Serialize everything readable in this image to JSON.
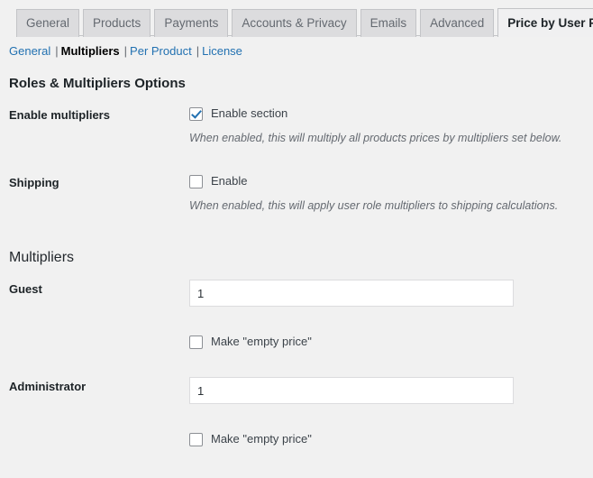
{
  "tabs": [
    {
      "label": "General",
      "active": false
    },
    {
      "label": "Products",
      "active": false
    },
    {
      "label": "Payments",
      "active": false
    },
    {
      "label": "Accounts & Privacy",
      "active": false
    },
    {
      "label": "Emails",
      "active": false
    },
    {
      "label": "Advanced",
      "active": false
    },
    {
      "label": "Price by User Role",
      "active": true
    }
  ],
  "subnav": {
    "items": [
      {
        "label": "General",
        "current": false
      },
      {
        "label": "Multipliers",
        "current": true
      },
      {
        "label": "Per Product",
        "current": false
      },
      {
        "label": "License",
        "current": false
      }
    ],
    "separator": "|"
  },
  "headings": {
    "roles_options": "Roles & Multipliers Options",
    "multipliers": "Multipliers"
  },
  "rows": {
    "enable_multipliers": {
      "label": "Enable multipliers",
      "checkbox_label": "Enable section",
      "checked": true,
      "description": "When enabled, this will multiply all products prices by multipliers set below."
    },
    "shipping": {
      "label": "Shipping",
      "checkbox_label": "Enable",
      "checked": false,
      "description": "When enabled, this will apply user role multipliers to shipping calculations."
    },
    "guest": {
      "label": "Guest",
      "value": "1",
      "placeholder": "",
      "empty_price_label": "Make \"empty price\"",
      "empty_price_checked": false
    },
    "administrator": {
      "label": "Administrator",
      "value": "1",
      "placeholder": "",
      "empty_price_label": "Make \"empty price\"",
      "empty_price_checked": false
    }
  },
  "colors": {
    "background": "#f1f1f1",
    "link": "#2271b1",
    "tab_inactive_bg": "#dcdcde",
    "tab_active_bg": "#f0f0f1",
    "border": "#c3c4c7",
    "text": "#3c434a",
    "muted_text": "#646970",
    "checkmark": "#2271b1"
  }
}
